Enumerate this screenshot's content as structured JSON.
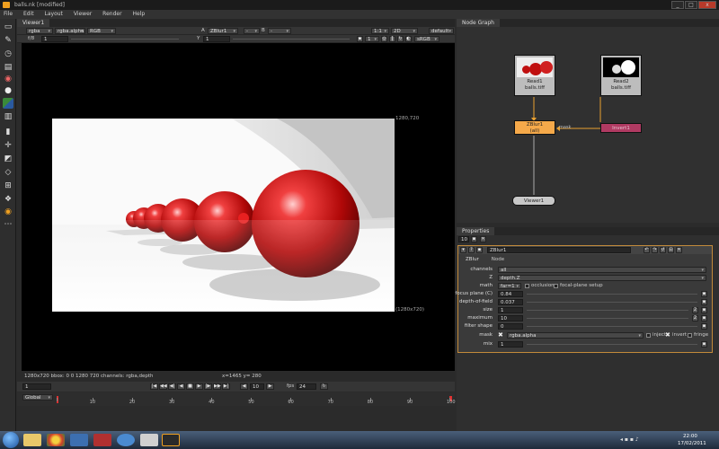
{
  "window": {
    "title": "balls.nk [modified]",
    "min": "_",
    "max": "□",
    "close": "x"
  },
  "menu": [
    "File",
    "Edit",
    "Layout",
    "Viewer",
    "Render",
    "Help"
  ],
  "viewer": {
    "tab": "Viewer1",
    "channels": "rgba",
    "alpha_channel": "rgba.alpha",
    "display_channel": "RGB",
    "a_input_label": "A",
    "a_input": "ZBlur1",
    "a_dash": "-",
    "b_input_label": "B",
    "b_input": "-",
    "zoom": "1:1",
    "view_mode": "2D",
    "lut_default": "default",
    "fstop_label": "f/8",
    "fstop_value": "1",
    "gain_label": "Y",
    "gain_value": "1",
    "proxy_value": "1",
    "colorspace": "sRGB",
    "format_top": "1280,720",
    "format_bottom": "(1280x720)",
    "info": "1280x720  bbox: 0 0 1280 720 channels: rgba,depth",
    "coords": "x=1465 y= 280"
  },
  "transport": {
    "frame": "1",
    "fps_label": "fps",
    "fps": "24",
    "step": "10"
  },
  "timeline": {
    "range": "Global",
    "labels": [
      "1",
      "10",
      "20",
      "30",
      "40",
      "50",
      "60",
      "70",
      "80",
      "90",
      "100"
    ],
    "end_marker": "100"
  },
  "node_graph": {
    "tab": "Node Graph",
    "nodes": [
      {
        "name": "Read1",
        "sub": "balls.tiff"
      },
      {
        "name": "Read2",
        "sub": "balls.tiff"
      },
      {
        "name": "ZBlur1",
        "sub": "(all)"
      },
      {
        "name": "Invert1",
        "sub": ""
      },
      {
        "name": "Viewer1",
        "sub": ""
      }
    ],
    "pipe_label": "mask",
    "colors": {
      "read": "#bdbdbd",
      "zblur": "#f5a94a",
      "invert": "#c0406a",
      "viewer": "#c8c8c8",
      "pipe": "#e8a030"
    }
  },
  "properties": {
    "tab": "Properties",
    "count": "10",
    "node_name": "ZBlur1",
    "tabs": [
      "ZBlur",
      "Node"
    ],
    "fields": {
      "channels": {
        "label": "channels",
        "value": "all"
      },
      "z": {
        "label": "Z",
        "value": "depth.Z"
      },
      "math": {
        "label": "math",
        "value": "far=1",
        "occlusion": "occlusion",
        "focal_setup": "focal-plane setup"
      },
      "focus": {
        "label": "focus plane (C)",
        "value": "0.84"
      },
      "dof": {
        "label": "depth-of-field",
        "value": "0.037"
      },
      "size": {
        "label": "size",
        "value": "1",
        "btn": "2"
      },
      "maximum": {
        "label": "maximum",
        "value": "10",
        "btn": "2"
      },
      "filter": {
        "label": "filter shape",
        "value": "0"
      },
      "mask": {
        "label": "mask",
        "value": "rgba.alpha",
        "inject": "inject",
        "invert": "invert",
        "fringe": "fringe"
      },
      "mix": {
        "label": "mix",
        "value": "1"
      }
    }
  },
  "taskbar": {
    "time": "22:00",
    "date": "17/02/2011"
  }
}
